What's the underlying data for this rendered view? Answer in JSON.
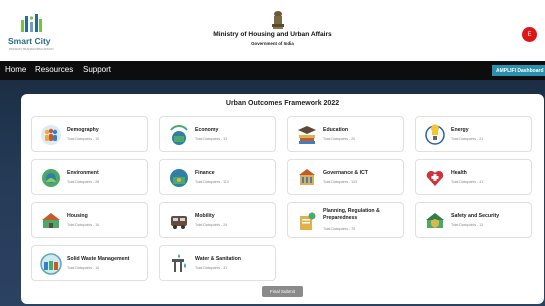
{
  "header": {
    "logo_text": "Smart City",
    "logo_tagline": "MISSION TRANSFORM-NATION",
    "ministry": "Ministry of Housing and Urban Affairs",
    "government": "Government of India",
    "avatar_letter": "E"
  },
  "nav": {
    "items": [
      "Home",
      "Resources",
      "Support"
    ],
    "dashboard_label": "AMPLIFI Dashboard"
  },
  "panel": {
    "title": "Urban Outcomes Framework 2022",
    "submit_label": "Final Submit",
    "cards": [
      {
        "name": "Demography",
        "sub": "Total Datapoints - 10",
        "icon": "people-icon"
      },
      {
        "name": "Economy",
        "sub": "Total Datapoints - 33",
        "icon": "economy-icon"
      },
      {
        "name": "Education",
        "sub": "Total Datapoints - 20",
        "icon": "education-icon"
      },
      {
        "name": "Energy",
        "sub": "Total Datapoints - 21",
        "icon": "energy-icon"
      },
      {
        "name": "Environment",
        "sub": "Total Datapoints - 28",
        "icon": "environment-icon"
      },
      {
        "name": "Finance",
        "sub": "Total Datapoints - 113",
        "icon": "finance-icon"
      },
      {
        "name": "Governance & ICT",
        "sub": "Total Datapoints - 103",
        "icon": "governance-icon"
      },
      {
        "name": "Health",
        "sub": "Total Datapoints - 41",
        "icon": "health-icon"
      },
      {
        "name": "Housing",
        "sub": "Total Datapoints - 16",
        "icon": "housing-icon"
      },
      {
        "name": "Mobility",
        "sub": "Total Datapoints - 24",
        "icon": "mobility-icon"
      },
      {
        "name": "Planning, Regulation & Preparedness",
        "sub": "Total Datapoints - 75",
        "icon": "planning-icon"
      },
      {
        "name": "Safety and Security",
        "sub": "Total Datapoints - 13",
        "icon": "safety-icon"
      },
      {
        "name": "Solid Waste Management",
        "sub": "Total Datapoints - 16",
        "icon": "waste-icon"
      },
      {
        "name": "Water & Sanitation",
        "sub": "Total Datapoints - 31",
        "icon": "water-icon"
      }
    ]
  }
}
